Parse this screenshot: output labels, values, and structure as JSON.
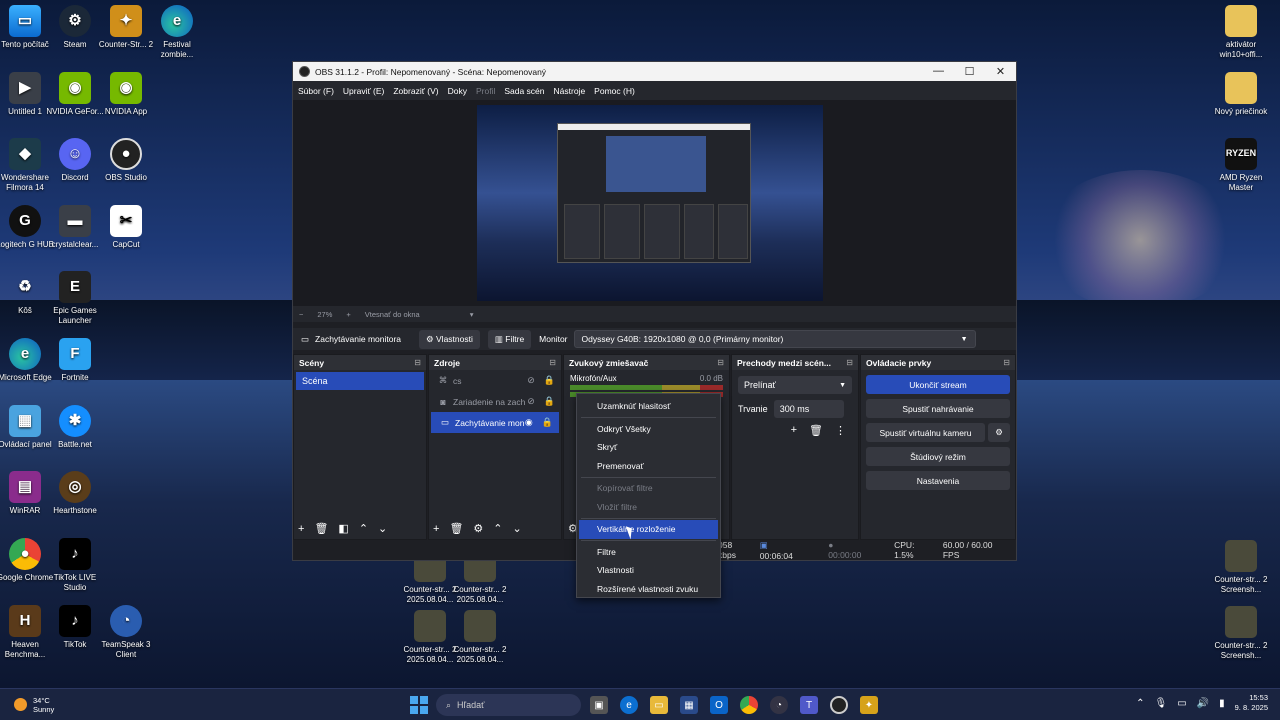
{
  "desktop": {
    "icons_left": [
      {
        "label": "Tento počítač",
        "icon": "pc",
        "cls": "i-pc",
        "glyph": "▭"
      },
      {
        "label": "Steam",
        "icon": "steam",
        "cls": "i-steam",
        "glyph": "⚙"
      },
      {
        "label": "Counter-Str... 2",
        "icon": "cs2",
        "cls": "i-cs",
        "glyph": "✦"
      },
      {
        "label": "Festival zombie...",
        "icon": "edge",
        "cls": "i-edge",
        "glyph": "e"
      },
      {
        "label": "Untitled 1",
        "icon": "file",
        "cls": "i-file",
        "glyph": "▶"
      },
      {
        "label": "NVIDIA GeFor...",
        "icon": "nvidia",
        "cls": "i-nv",
        "glyph": "◉"
      },
      {
        "label": "NVIDIA App",
        "icon": "nvidia",
        "cls": "i-nv",
        "glyph": "◉"
      },
      {
        "label": "Wondershare Filmora 14",
        "icon": "filmora",
        "cls": "i-fil",
        "glyph": "◆"
      },
      {
        "label": "Discord",
        "icon": "discord",
        "cls": "i-disc",
        "glyph": "☺"
      },
      {
        "label": "OBS Studio",
        "icon": "obs",
        "cls": "i-obs",
        "glyph": "●"
      },
      {
        "label": "Logitech G HUB",
        "icon": "logitech",
        "cls": "i-log",
        "glyph": "G"
      },
      {
        "label": "crystalclear...",
        "icon": "image",
        "cls": "i-file",
        "glyph": "▬"
      },
      {
        "label": "CapCut",
        "icon": "capcut",
        "cls": "i-cc",
        "glyph": "✂"
      },
      {
        "label": "Kôš",
        "icon": "recycle-bin",
        "cls": "i-bin",
        "glyph": "♻"
      },
      {
        "label": "Epic Games Launcher",
        "icon": "epic",
        "cls": "i-epic",
        "glyph": "E"
      },
      {
        "label": "Microsoft Edge",
        "icon": "edge",
        "cls": "i-edge",
        "glyph": "e"
      },
      {
        "label": "Fortnite",
        "icon": "fortnite",
        "cls": "i-fn",
        "glyph": "F"
      },
      {
        "label": "Ovládací panel",
        "icon": "control-panel",
        "cls": "i-ctl",
        "glyph": "▦"
      },
      {
        "label": "Battle.net",
        "icon": "battlenet",
        "cls": "i-bnet",
        "glyph": "✱"
      },
      {
        "label": "WinRAR",
        "icon": "winrar",
        "cls": "i-rar",
        "glyph": "▤"
      },
      {
        "label": "Hearthstone",
        "icon": "hearthstone",
        "cls": "i-hs",
        "glyph": "◎"
      },
      {
        "label": "Google Chrome",
        "icon": "chrome",
        "cls": "i-chrome",
        "glyph": "●"
      },
      {
        "label": "TikTok LIVE Studio",
        "icon": "tiktok",
        "cls": "i-tt",
        "glyph": "♪"
      },
      {
        "label": "Heaven Benchma...",
        "icon": "heaven",
        "cls": "i-heav",
        "glyph": "H"
      },
      {
        "label": "TikTok",
        "icon": "tiktok",
        "cls": "i-tt",
        "glyph": "♪"
      },
      {
        "label": "TeamSpeak 3 Client",
        "icon": "teamspeak",
        "cls": "i-ts",
        "glyph": "◔"
      }
    ],
    "icons_right": [
      {
        "label": "aktivátor win10+offi...",
        "icon": "folder",
        "cls": "i-folder",
        "glyph": ""
      },
      {
        "label": "Nový priečinok",
        "icon": "folder",
        "cls": "i-folder",
        "glyph": ""
      },
      {
        "label": "AMD Ryzen Master",
        "icon": "ryzen",
        "cls": "i-ryzen",
        "glyph": "RYZEN"
      },
      {
        "label": "Counter-str... 2 Screensh...",
        "icon": "screenshot",
        "cls": "i-thumb",
        "glyph": ""
      },
      {
        "label": "Counter-str... 2 Screensh...",
        "icon": "screenshot",
        "cls": "i-thumb",
        "glyph": ""
      }
    ],
    "icons_mid": [
      {
        "label": "Counter-str... 2 2025.08.04...",
        "icon": "video",
        "cls": "i-thumb",
        "glyph": ""
      },
      {
        "label": "Counter-str... 2 2025.08.04...",
        "icon": "video",
        "cls": "i-thumb",
        "glyph": ""
      },
      {
        "label": "Counter-str... 2 2025.08.04...",
        "icon": "video",
        "cls": "i-thumb",
        "glyph": ""
      },
      {
        "label": "Counter-str... 2 2025.08.04...",
        "icon": "video",
        "cls": "i-thumb",
        "glyph": ""
      }
    ]
  },
  "obs": {
    "title": "OBS 31.1.2 - Profil: Nepomenovaný - Scéna: Nepomenovaný",
    "menu": [
      "Súbor (F)",
      "Upraviť (E)",
      "Zobraziť (V)",
      "Doky",
      "Profil",
      "Sada scén",
      "Nástroje",
      "Pomoc (H)"
    ],
    "zoom": {
      "minus": "−",
      "value": "27%",
      "plus": "+",
      "fit": "Vtesnať do okna",
      "dd": "▾"
    },
    "source_bar": {
      "source_name": "Zachytávanie monitora",
      "properties": "Vlastnosti",
      "filters": "Filtre",
      "monitor_label": "Monitor",
      "monitor_value": "Odyssey G40B: 1920x1080 @ 0,0 (Primárny monitor)"
    },
    "scenes": {
      "title": "Scény",
      "items": [
        "Scéna"
      ]
    },
    "sources": {
      "title": "Zdroje",
      "items": [
        "cs",
        "Zariadenie na zach",
        "Zachytávanie mon"
      ]
    },
    "mixer": {
      "title": "Zvukový zmiešavač",
      "channel": "Mikrofón/Aux",
      "level": "0.0 dB"
    },
    "transitions": {
      "title": "Prechody medzi scén...",
      "selected": "Prelínať",
      "duration_label": "Trvanie",
      "duration_value": "300 ms"
    },
    "controls": {
      "title": "Ovládacie prvky",
      "buttons": [
        "Ukončiť stream",
        "Spustiť nahrávanie",
        "Spustiť virtuálnu kameru",
        "Štúdiový režim",
        "Nastavenia"
      ]
    },
    "status": {
      "bitrate": "058 kbps",
      "stream_time": "00:06:04",
      "rec_time": "00:00:00",
      "cpu": "CPU: 1.5%",
      "fps": "60.00 / 60.00 FPS"
    }
  },
  "context_menu": {
    "items": [
      "Uzamknúť hlasitosť",
      "Odkryť Všetky",
      "Skryť",
      "Premenovať",
      "Kopírovať filtre",
      "Vložiť filtre",
      "Vertikálne rozloženie",
      "Filtre",
      "Vlastnosti",
      "Rozšírené vlastnosti zvuku"
    ],
    "highlighted": "Vertikálne rozloženie"
  },
  "taskbar": {
    "temperature": "34°C",
    "weather": "Sunny",
    "search_placeholder": "Hľadať",
    "time": "15:53",
    "date": "9. 8. 2025"
  }
}
